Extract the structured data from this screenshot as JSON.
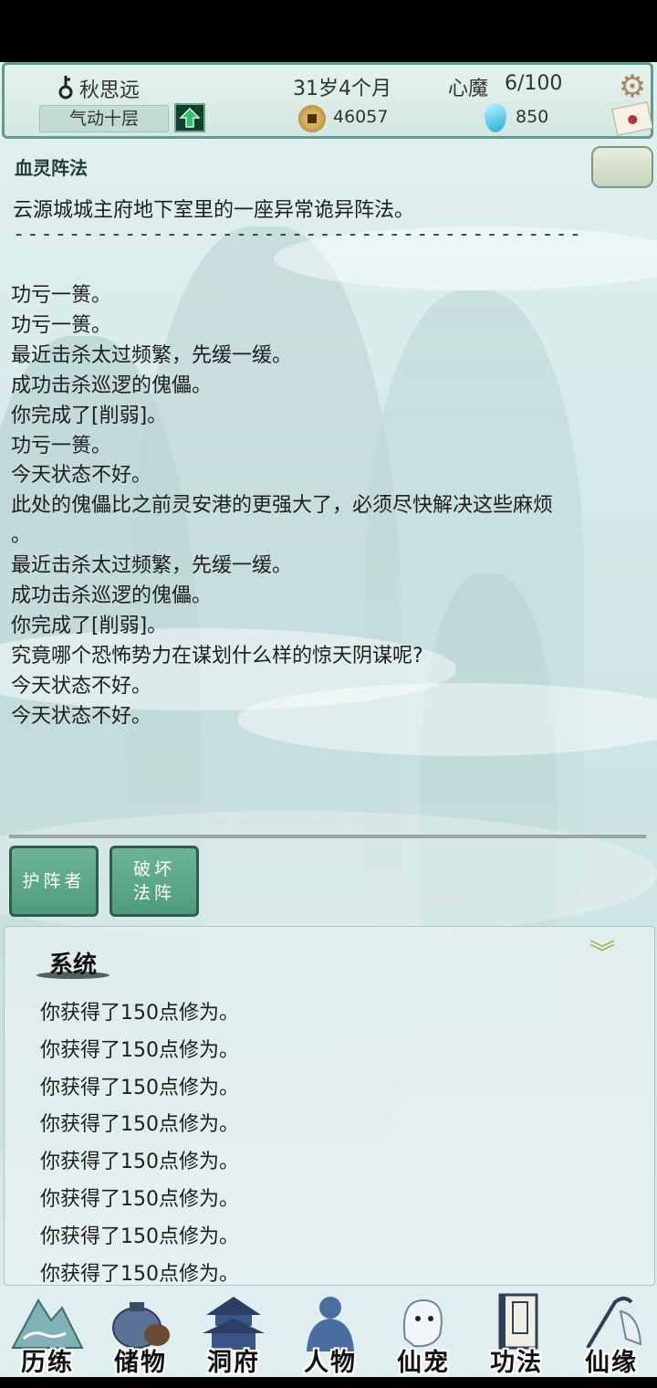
{
  "header": {
    "player_name": "秋思远",
    "age": "31岁4个月",
    "heart_demon_label": "心魔",
    "heart_demon_value": "6/100",
    "realm": "气动十层",
    "coins": "46057",
    "spirit_stones": "850",
    "icons": [
      "key-icon",
      "upgrade-arrow-icon",
      "coin-icon",
      "spirit-stone-icon",
      "gear-icon",
      "mail-icon"
    ]
  },
  "formation": {
    "title": "血灵阵法",
    "description": "云源城城主府地下室里的一座异常诡异阵法。",
    "divider": "-----------------------------------------",
    "log": [
      "功亏一篑。",
      "功亏一篑。",
      "最近击杀太过频繁，先缓一缓。",
      "成功击杀巡逻的傀儡。",
      "你完成了[削弱]。",
      "功亏一篑。",
      "今天状态不好。",
      "此处的傀儡比之前灵安港的更强大了，必须尽快解决这些麻烦",
      "。",
      "最近击杀太过频繁，先缓一缓。",
      "成功击杀巡逻的傀儡。",
      "你完成了[削弱]。",
      "究竟哪个恐怖势力在谋划什么样的惊天阴谋呢?",
      "今天状态不好。",
      "今天状态不好。"
    ]
  },
  "actions": {
    "guardian": "护阵者",
    "destroy_line1": "破坏",
    "destroy_line2": "法阵"
  },
  "system": {
    "title": "系统",
    "collapse_icon": "double-chevron-down-icon",
    "messages": [
      "你获得了150点修为。",
      "你获得了150点修为。",
      "你获得了150点修为。",
      "你获得了150点修为。",
      "你获得了150点修为。",
      "你获得了150点修为。",
      "你获得了150点修为。",
      "你获得了150点修为。"
    ]
  },
  "nav": [
    {
      "label": "历练",
      "icon": "mountain-icon"
    },
    {
      "label": "储物",
      "icon": "pouch-icon"
    },
    {
      "label": "洞府",
      "icon": "pagoda-icon"
    },
    {
      "label": "人物",
      "icon": "figure-icon"
    },
    {
      "label": "仙宠",
      "icon": "spirit-pet-icon"
    },
    {
      "label": "功法",
      "icon": "book-icon"
    },
    {
      "label": "仙缘",
      "icon": "crane-icon"
    }
  ],
  "colors": {
    "accent": "#5f9e8c",
    "button": "#4e9c7d",
    "background": "#dfeeee"
  }
}
